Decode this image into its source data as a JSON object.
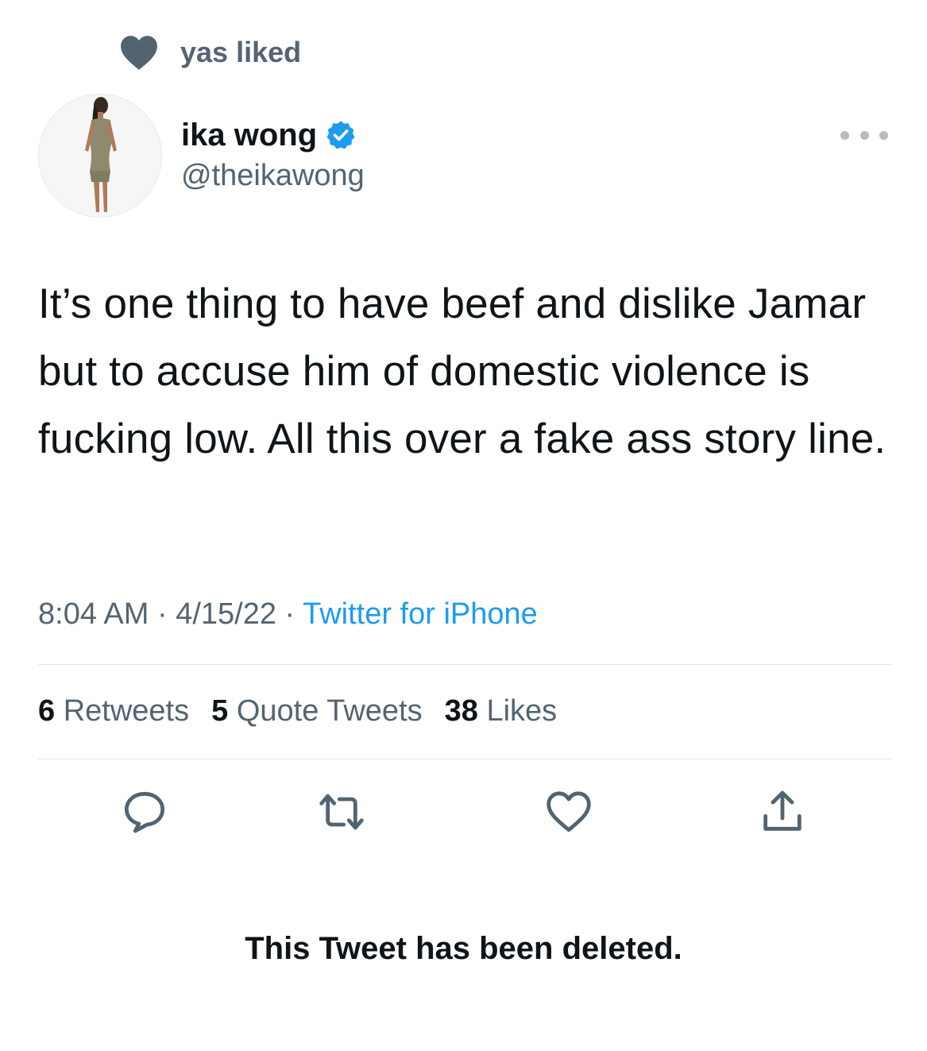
{
  "social_context": {
    "icon": "heart-icon",
    "text": "yas liked"
  },
  "author": {
    "name": "ika wong",
    "handle": "@theikawong",
    "verified_icon": "verified-badge-icon",
    "more_icon": "more-options-icon"
  },
  "tweet": {
    "text": "It’s one thing to have beef and dislike Jamar but to accuse him of domestic violence is fucking low. All this over a fake ass story line."
  },
  "meta": {
    "time": "8:04 AM",
    "date": "4/15/22",
    "source": "Twitter for iPhone",
    "separator": " · "
  },
  "stats": {
    "retweets_count": "6",
    "retweets_label": "Retweets",
    "quotes_count": "5",
    "quotes_label": "Quote Tweets",
    "likes_count": "38",
    "likes_label": "Likes"
  },
  "actions": {
    "reply_icon": "reply-icon",
    "retweet_icon": "retweet-icon",
    "like_icon": "like-heart-icon",
    "share_icon": "share-icon"
  },
  "notice": {
    "deleted_text": "This Tweet has been deleted."
  },
  "colors": {
    "text_primary": "#0f1419",
    "text_secondary": "#536471",
    "link": "#1d9bf0",
    "verified": "#1d9bf0",
    "divider": "#e1e6ea"
  }
}
